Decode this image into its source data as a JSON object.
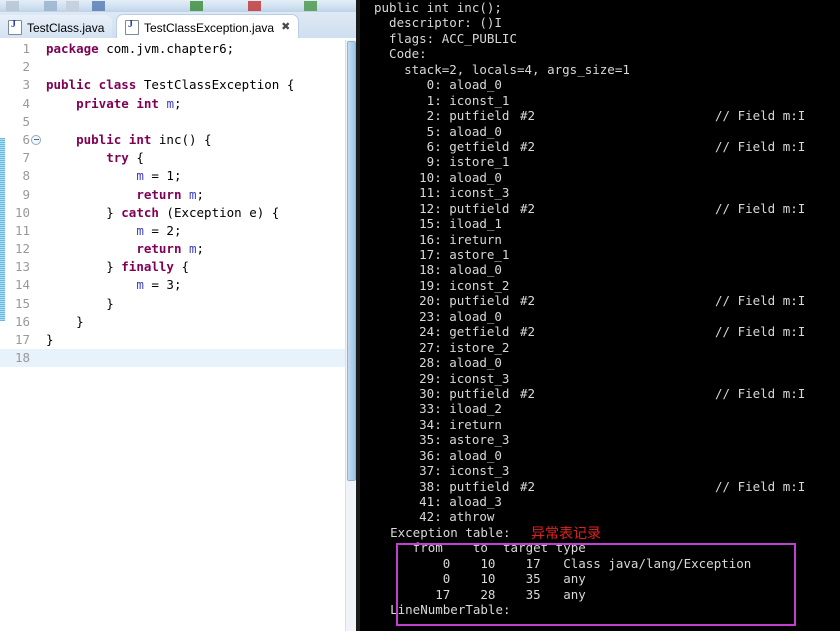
{
  "window": {
    "title": "Eclipse IDE with javap bytecode output"
  },
  "toolbar": {
    "present": true
  },
  "editor": {
    "tabs": [
      {
        "label": "TestClass.java",
        "icon": "java-file-icon",
        "active": false,
        "closable": false
      },
      {
        "label": "TestClassException.java",
        "icon": "java-file-icon",
        "active": true,
        "closable": true,
        "close_glyph": "✖"
      }
    ],
    "language": "java",
    "current_line": 18,
    "fold_marker_line": 6,
    "annotation_bar_lines": [
      6,
      16
    ],
    "colors": {
      "keyword": "#7f0055",
      "field": "#4040c0",
      "text": "#000000",
      "line_number": "#999999",
      "current_line_bg": "#e8f2fb"
    },
    "lines": [
      {
        "n": "1",
        "segments": [
          {
            "t": "package",
            "c": "kw"
          },
          {
            "t": " com.jvm.chapter6;",
            "c": "plain"
          }
        ]
      },
      {
        "n": "2",
        "segments": []
      },
      {
        "n": "3",
        "segments": [
          {
            "t": "public class",
            "c": "kw"
          },
          {
            "t": " TestClassException {",
            "c": "plain"
          }
        ]
      },
      {
        "n": "4",
        "segments": [
          {
            "t": "    ",
            "c": "plain"
          },
          {
            "t": "private int",
            "c": "kw"
          },
          {
            "t": " ",
            "c": "plain"
          },
          {
            "t": "m",
            "c": "fld"
          },
          {
            "t": ";",
            "c": "plain"
          }
        ]
      },
      {
        "n": "5",
        "segments": []
      },
      {
        "n": "6",
        "segments": [
          {
            "t": "    ",
            "c": "plain"
          },
          {
            "t": "public int",
            "c": "kw"
          },
          {
            "t": " inc() {",
            "c": "plain"
          }
        ],
        "fold": true
      },
      {
        "n": "7",
        "segments": [
          {
            "t": "        ",
            "c": "plain"
          },
          {
            "t": "try",
            "c": "kw"
          },
          {
            "t": " {",
            "c": "plain"
          }
        ]
      },
      {
        "n": "8",
        "segments": [
          {
            "t": "            ",
            "c": "plain"
          },
          {
            "t": "m",
            "c": "fld"
          },
          {
            "t": " = 1;",
            "c": "plain"
          }
        ]
      },
      {
        "n": "9",
        "segments": [
          {
            "t": "            ",
            "c": "plain"
          },
          {
            "t": "return",
            "c": "kw"
          },
          {
            "t": " ",
            "c": "plain"
          },
          {
            "t": "m",
            "c": "fld"
          },
          {
            "t": ";",
            "c": "plain"
          }
        ]
      },
      {
        "n": "10",
        "segments": [
          {
            "t": "        } ",
            "c": "plain"
          },
          {
            "t": "catch",
            "c": "kw"
          },
          {
            "t": " (Exception e) {",
            "c": "plain"
          }
        ]
      },
      {
        "n": "11",
        "segments": [
          {
            "t": "            ",
            "c": "plain"
          },
          {
            "t": "m",
            "c": "fld"
          },
          {
            "t": " = 2;",
            "c": "plain"
          }
        ]
      },
      {
        "n": "12",
        "segments": [
          {
            "t": "            ",
            "c": "plain"
          },
          {
            "t": "return",
            "c": "kw"
          },
          {
            "t": " ",
            "c": "plain"
          },
          {
            "t": "m",
            "c": "fld"
          },
          {
            "t": ";",
            "c": "plain"
          }
        ]
      },
      {
        "n": "13",
        "segments": [
          {
            "t": "        } ",
            "c": "plain"
          },
          {
            "t": "finally",
            "c": "kw"
          },
          {
            "t": " {",
            "c": "plain"
          }
        ]
      },
      {
        "n": "14",
        "segments": [
          {
            "t": "            ",
            "c": "plain"
          },
          {
            "t": "m",
            "c": "fld"
          },
          {
            "t": " = 3;",
            "c": "plain"
          }
        ]
      },
      {
        "n": "15",
        "segments": [
          {
            "t": "        }",
            "c": "plain"
          }
        ]
      },
      {
        "n": "16",
        "segments": [
          {
            "t": "    }",
            "c": "plain"
          }
        ]
      },
      {
        "n": "17",
        "segments": [
          {
            "t": "}",
            "c": "plain"
          }
        ]
      },
      {
        "n": "18",
        "segments": [],
        "current": true
      }
    ]
  },
  "console": {
    "background": "#000000",
    "foreground": "#d8d8d8",
    "lines": [
      {
        "main": "public int inc();"
      },
      {
        "main": "  descriptor: ()I"
      },
      {
        "main": "  flags: ACC_PUBLIC"
      },
      {
        "main": "  Code:"
      },
      {
        "main": "    stack=2, locals=4, args_size=1"
      },
      {
        "main": "       0: aload_0"
      },
      {
        "main": "       1: iconst_1"
      },
      {
        "main": "       2: putfield",
        "op2": "#2",
        "comment": "// Field m:I"
      },
      {
        "main": "       5: aload_0"
      },
      {
        "main": "       6: getfield",
        "op2": "#2",
        "comment": "// Field m:I"
      },
      {
        "main": "       9: istore_1"
      },
      {
        "main": "      10: aload_0"
      },
      {
        "main": "      11: iconst_3"
      },
      {
        "main": "      12: putfield",
        "op2": "#2",
        "comment": "// Field m:I"
      },
      {
        "main": "      15: iload_1"
      },
      {
        "main": "      16: ireturn"
      },
      {
        "main": "      17: astore_1"
      },
      {
        "main": "      18: aload_0"
      },
      {
        "main": "      19: iconst_2"
      },
      {
        "main": "      20: putfield",
        "op2": "#2",
        "comment": "// Field m:I"
      },
      {
        "main": "      23: aload_0"
      },
      {
        "main": "      24: getfield",
        "op2": "#2",
        "comment": "// Field m:I"
      },
      {
        "main": "      27: istore_2"
      },
      {
        "main": "      28: aload_0"
      },
      {
        "main": "      29: iconst_3"
      },
      {
        "main": "      30: putfield",
        "op2": "#2",
        "comment": "// Field m:I"
      },
      {
        "main": "      33: iload_2"
      },
      {
        "main": "      34: ireturn"
      },
      {
        "main": "      35: astore_3"
      },
      {
        "main": "      36: aload_0"
      },
      {
        "main": "      37: iconst_3"
      },
      {
        "main": "      38: putfield",
        "op2": "#2",
        "comment": "// Field m:I"
      },
      {
        "main": "      41: aload_3"
      },
      {
        "main": "      42: athrow"
      }
    ],
    "exception_table": {
      "highlight_color": "#c040d0",
      "title": "    Exception table:",
      "header": "       from    to  target type",
      "rows": [
        "           0    10    17   Class java/lang/Exception",
        "           0    10    35   any",
        "          17    28    35   any"
      ]
    },
    "trailing_line": "    LineNumberTable:"
  },
  "annotation": {
    "text": "异常表记录",
    "color": "#e02020"
  }
}
